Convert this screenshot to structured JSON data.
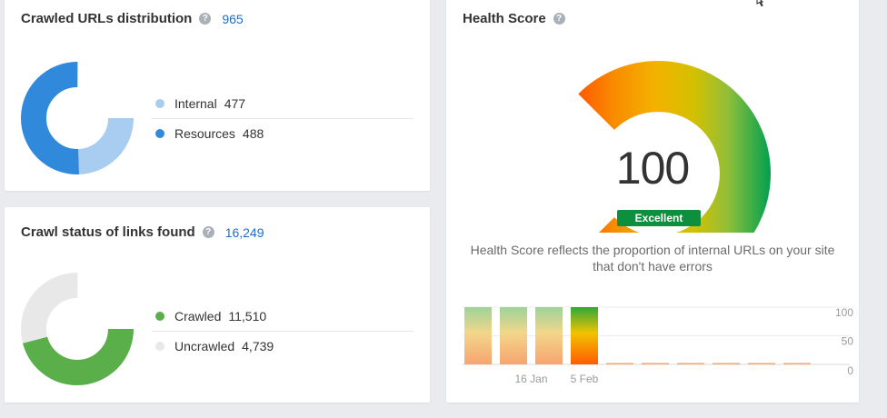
{
  "crawled_urls": {
    "title": "Crawled URLs distribution",
    "help_icon": "question-icon",
    "total": "965",
    "legend": [
      {
        "label": "Internal",
        "value": "477",
        "color": "#a8cdf0"
      },
      {
        "label": "Resources",
        "value": "488",
        "color": "#3189db"
      }
    ]
  },
  "crawl_status": {
    "title": "Crawl status of links found",
    "help_icon": "question-icon",
    "total": "16,249",
    "legend": [
      {
        "label": "Crawled",
        "value": "11,510",
        "color": "#5aaf4a"
      },
      {
        "label": "Uncrawled",
        "value": "4,739",
        "color": "#e8e8e8"
      }
    ]
  },
  "health": {
    "title": "Health Score",
    "help_icon": "question-icon",
    "score": "100",
    "score_value": 100,
    "badge": "Excellent",
    "badge_color": "#0e8f3d",
    "description": "Health Score reflects the proportion of internal URLs on your site that don't have errors",
    "chart": {
      "y_ticks": [
        "100",
        "50",
        "0"
      ],
      "x_ticks": [
        "16 Jan",
        "5 Feb"
      ],
      "bars": [
        100,
        100,
        100,
        100,
        0,
        0,
        0,
        0,
        0,
        0
      ]
    }
  }
}
